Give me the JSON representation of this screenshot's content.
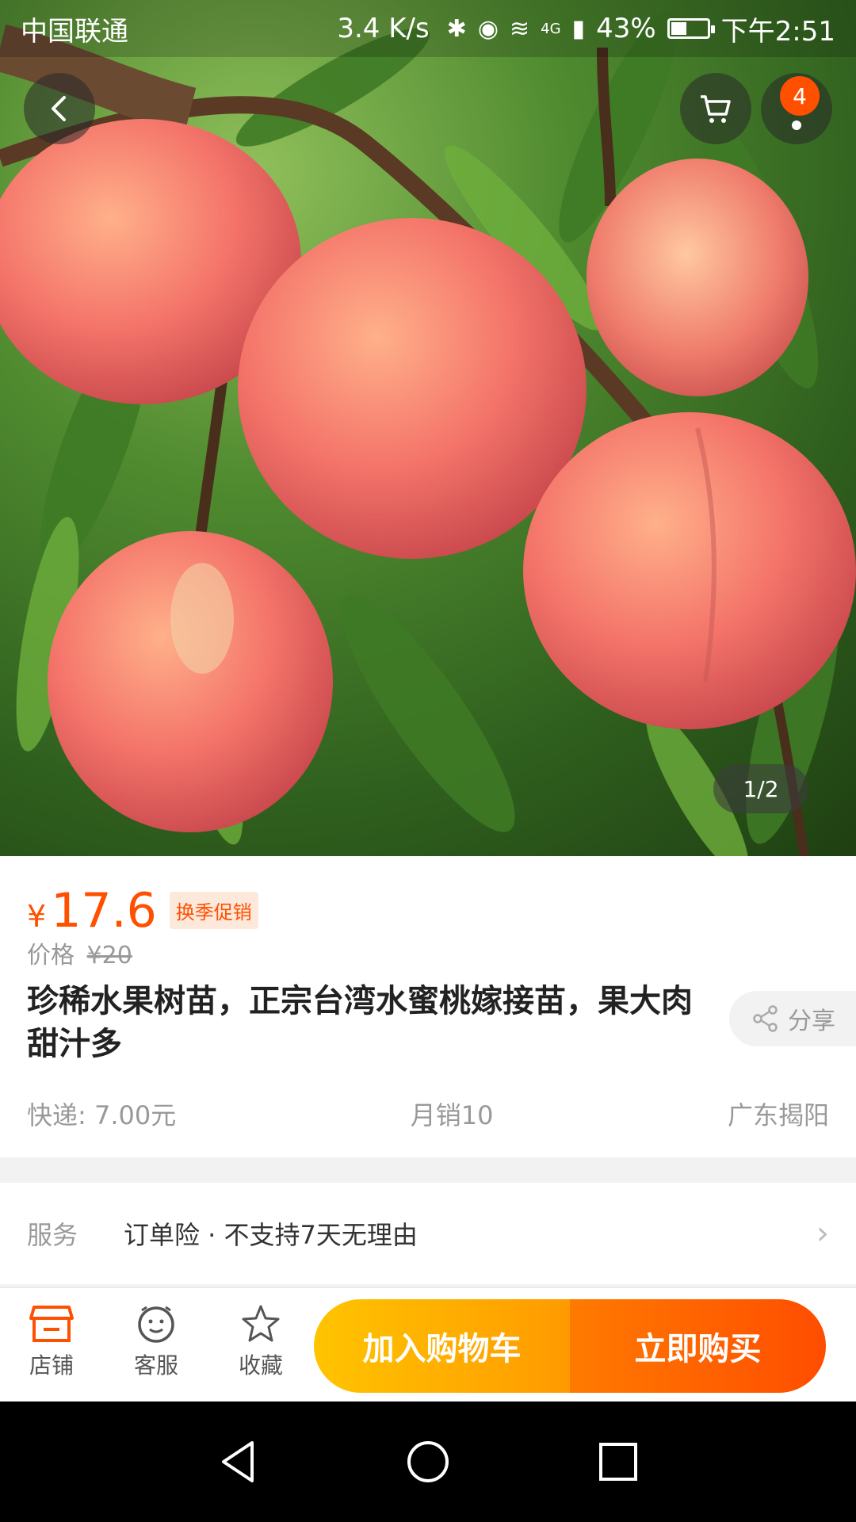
{
  "status_bar": {
    "carrier": "中国联通",
    "net_speed": "3.4 K/s",
    "network": "4G",
    "battery": "43%",
    "time": "下午2:51",
    "battery_level": 0.43
  },
  "gallery": {
    "indicator": "1/2"
  },
  "header": {
    "cart_badge": "4"
  },
  "product": {
    "currency": "¥",
    "price": "17.6",
    "promo_tag": "换季促销",
    "orig_label": "价格",
    "orig_price": "¥20",
    "title": "珍稀水果树苗，正宗台湾水蜜桃嫁接苗，果大肉甜汁多",
    "share_label": "分享",
    "shipping": "快递: 7.00元",
    "monthly_sales": "月销10",
    "location": "广东揭阳"
  },
  "service": {
    "label": "服务",
    "value": "订单险 · 不支持7天无理由"
  },
  "actions": {
    "store": "店铺",
    "customer_service": "客服",
    "favorite": "收藏",
    "add_to_cart": "加入购物车",
    "buy_now": "立即购买"
  },
  "colors": {
    "accent": "#ff5000",
    "cart_gradient_start": "#ffc400",
    "buy_gradient_end": "#ff4d00"
  }
}
